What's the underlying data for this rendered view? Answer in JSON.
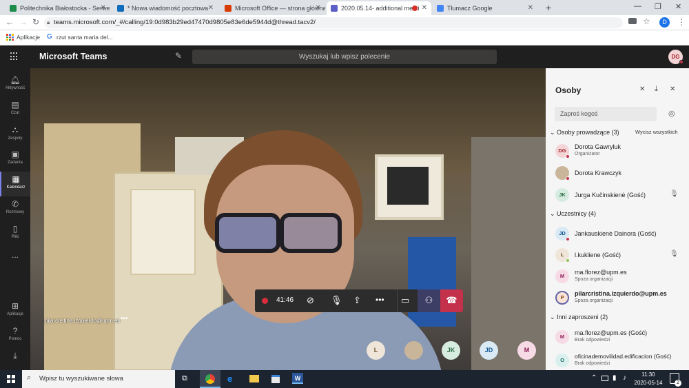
{
  "browser": {
    "tabs": [
      {
        "title": "Politechnika Białostocka - Serwer",
        "color": "#1e8c4a"
      },
      {
        "title": "* Nowa wiadomość pocztowa",
        "color": "#0f6cbd"
      },
      {
        "title": "Microsoft Office — strona główna",
        "color": "#d83b01"
      },
      {
        "title": "2020.05.14- additional meeti",
        "color": "#5b5fc7"
      },
      {
        "title": "Tłumacz Google",
        "color": "#4285f4"
      }
    ],
    "url": "teams.microsoft.com/_#/calling/19:0d983b29ed47470d9805e83e6de5944d@thread.tacv2/",
    "profile_initial": "D",
    "bookmarks": [
      "Aplikacje",
      "rzut santa maria del..."
    ]
  },
  "teams": {
    "app_title": "Microsoft Teams",
    "search_placeholder": "Wyszukaj lub wpisz polecenie",
    "user_initials": "DG",
    "rail": [
      {
        "label": "Aktywność",
        "icon": "bell-icon"
      },
      {
        "label": "Czat",
        "icon": "chat-icon"
      },
      {
        "label": "Zespoły",
        "icon": "teams-icon"
      },
      {
        "label": "Zadania",
        "icon": "tasks-icon"
      },
      {
        "label": "Kalendarz",
        "icon": "calendar-icon"
      },
      {
        "label": "Rozmowy",
        "icon": "phone-icon"
      },
      {
        "label": "Pliki",
        "icon": "files-icon"
      },
      {
        "label": "...",
        "icon": "more-icon"
      },
      {
        "label": "Aplikacje",
        "icon": "apps-icon"
      },
      {
        "label": "Pomoc",
        "icon": "help-icon"
      }
    ]
  },
  "call": {
    "speaker_name": "pilarcristina.izquierdo@upm.es",
    "timer": "41:46",
    "bottom_avatars": [
      "L",
      "",
      "JK",
      "JD",
      "M"
    ]
  },
  "panel": {
    "title": "Osoby",
    "invite_placeholder": "Zaproś kogoś",
    "sections": [
      {
        "title": "Osoby prowadzące (3)",
        "action": "Wycisz wszystkich",
        "people": [
          {
            "initials": "DG",
            "name": "Dorota Gawryluk",
            "sub": "Organizator",
            "bg": "#f4d5d7",
            "fg": "#a4262c",
            "status": "#c4314b",
            "bold": false
          },
          {
            "initials": "",
            "name": "Dorota Krawczyk",
            "sub": "",
            "bg": "#c9b59a",
            "fg": "#333",
            "status": "#c4314b",
            "bold": false
          },
          {
            "initials": "JK",
            "name": "Jurga Kučinskienė (Gość)",
            "sub": "",
            "bg": "#d6ece0",
            "fg": "#2b6a41",
            "status": "",
            "bold": false,
            "muted": true
          }
        ]
      },
      {
        "title": "Uczestnicy (4)",
        "action": "",
        "people": [
          {
            "initials": "JD",
            "name": "Jankauskienė Dainora (Gość)",
            "sub": "",
            "bg": "#d9eaf5",
            "fg": "#0f5494",
            "status": "#c4314b",
            "bold": false
          },
          {
            "initials": "L",
            "name": "l.kukliene (Gość)",
            "sub": "",
            "bg": "#efe6d9",
            "fg": "#6b4f29",
            "status": "#92c353",
            "bold": false,
            "muted": true
          },
          {
            "initials": "M",
            "name": "ma.florez@upm.es",
            "sub": "Spoza organizacji",
            "bg": "#f6dbe6",
            "fg": "#8d1f56",
            "status": "",
            "bold": false
          },
          {
            "initials": "P",
            "name": "pilarcristina.izquierdo@upm.es",
            "sub": "Spoza organizacji",
            "bg": "#f8e3d6",
            "fg": "#8a3f0d",
            "status": "",
            "bold": true,
            "ring": true
          }
        ]
      },
      {
        "title": "Inni zaproszeni (2)",
        "action": "",
        "people": [
          {
            "initials": "M",
            "name": "ma.florez@upm.es (Gość)",
            "sub": "Brak odpowiedzi",
            "bg": "#f6dbe6",
            "fg": "#8d1f56",
            "status": "",
            "bold": false
          },
          {
            "initials": "O",
            "name": "oficinademovilidad.edificacion (Gość)",
            "sub": "Brak odpowiedzi",
            "bg": "#d9f0ef",
            "fg": "#1a6b66",
            "status": "",
            "bold": false
          }
        ]
      }
    ]
  },
  "taskbar": {
    "search_placeholder": "Wpisz tu wyszukiwane słowa",
    "time": "11:30",
    "date": "2020-05-14",
    "notifications": "2"
  }
}
